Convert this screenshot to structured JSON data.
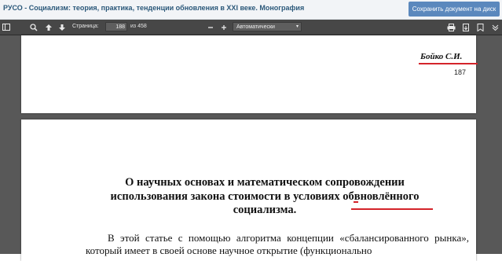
{
  "header": {
    "title": "РУСО - Социализм: теория, практика, тенденции обновления в XXI веке. Монография",
    "save_label": "Сохранить документ на диск"
  },
  "toolbar": {
    "page_label": "Страница:",
    "page_current": "188",
    "page_total": "из 458",
    "zoom_value": "Автоматически",
    "icons": [
      "sidebar-toggle-icon",
      "search-icon",
      "arrow-up-icon",
      "arrow-down-icon",
      "zoom-out-icon",
      "zoom-in-icon",
      "print-icon",
      "download-icon",
      "bookmark-icon",
      "more-tools-icon"
    ]
  },
  "page_prev": {
    "author": "Бойко С.И.",
    "page_number": "187"
  },
  "page_current": {
    "heading_lines": [
      "О научных основах и математическом сопровождении",
      "использования закона стоимости в условиях обвновлённого",
      "социализма."
    ],
    "body_lines": [
      "В этой статье с помощью алгоритма концепции «сбалансированного",
      "рынка», который имеет в своей основе научное открытие (функционально"
    ]
  },
  "colors": {
    "title_text": "#2b587a",
    "save_button": "#5b88bd",
    "toolbar_bg": "#474747",
    "viewer_bg": "#585858",
    "spellcheck": "#d4242a"
  }
}
